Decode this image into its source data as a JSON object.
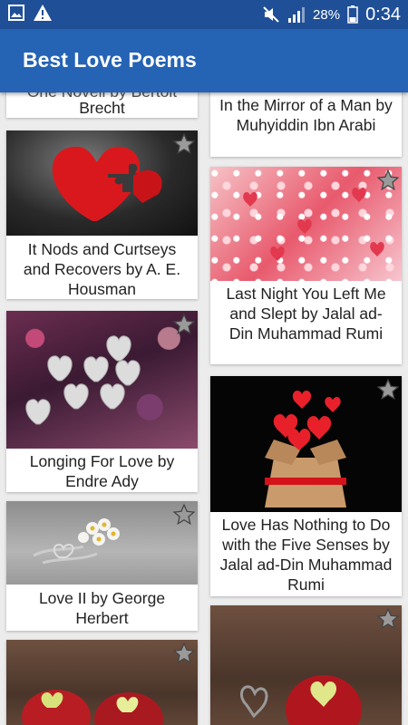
{
  "status_bar": {
    "battery_percent": "28%",
    "time": "0:34"
  },
  "app_bar": {
    "title": "Best Love Poems"
  },
  "poems": [
    {
      "title": "Brecht",
      "partial_title": "One Novell by Bertolt"
    },
    {
      "title": "In the Mirror of a Man by Muhyiddin Ibn Arabi"
    },
    {
      "title": "It Nods and Curtseys and Recovers by A. E. Housman"
    },
    {
      "title": "Last Night You Left Me and Slept by Jalal ad-Din Muhammad Rumi"
    },
    {
      "title": "Longing For Love by Endre Ady"
    },
    {
      "title": "Love Has Nothing to Do with the Five Senses by Jalal ad-Din Muhammad Rumi"
    },
    {
      "title": "Love II by George Herbert"
    },
    {
      "title": ""
    },
    {
      "title": ""
    }
  ],
  "colors": {
    "status_bar": "#1f4f97",
    "app_bar": "#2563b4",
    "background": "#ececec"
  }
}
